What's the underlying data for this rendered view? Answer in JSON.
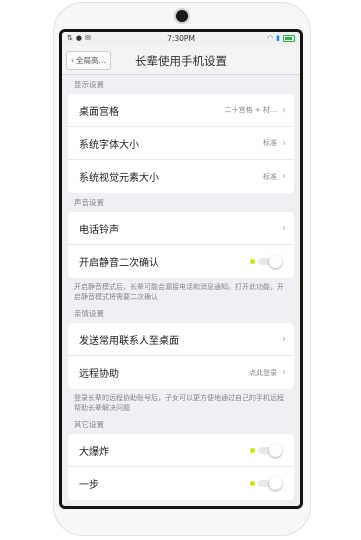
{
  "status_bar": {
    "time": "7:30PM",
    "left_icons": [
      "signal-icon",
      "chat-icon",
      "mail-icon"
    ],
    "right_icons": [
      "wifi-icon",
      "network-icon",
      "battery-icon"
    ]
  },
  "header": {
    "back_label": "全局高…",
    "title": "长辈使用手机设置"
  },
  "sections": {
    "display": {
      "label": "显示设置",
      "items": [
        {
          "label": "桌面宫格",
          "value": "二十宫格 + 材…"
        },
        {
          "label": "系统字体大小",
          "value": "标准"
        },
        {
          "label": "系统视觉元素大小",
          "value": "标准"
        }
      ]
    },
    "sound": {
      "label": "声音设置",
      "items": [
        {
          "label": "电话铃声"
        },
        {
          "label": "开启静音二次确认",
          "toggle": "on"
        }
      ],
      "note": "开启静音模式后，长辈可能会漏接电话和消息通知。打开此功能，开启静音模式将需要二次确认"
    },
    "family": {
      "label": "亲情设置",
      "items": [
        {
          "label": "发送常用联系人至桌面"
        },
        {
          "label": "远程协助",
          "value": "点此登录"
        }
      ],
      "note": "登录长辈的远程协助账号后，子女可以更方便地通过自己的手机远程帮助长辈解决问题"
    },
    "other": {
      "label": "其它设置",
      "items": [
        {
          "label": "大爆炸",
          "toggle": "on"
        },
        {
          "label": "一步",
          "toggle": "on"
        }
      ]
    }
  },
  "colors": {
    "toggle_dot": "#c8e600",
    "background": "#efeff4",
    "card": "#ffffff"
  }
}
